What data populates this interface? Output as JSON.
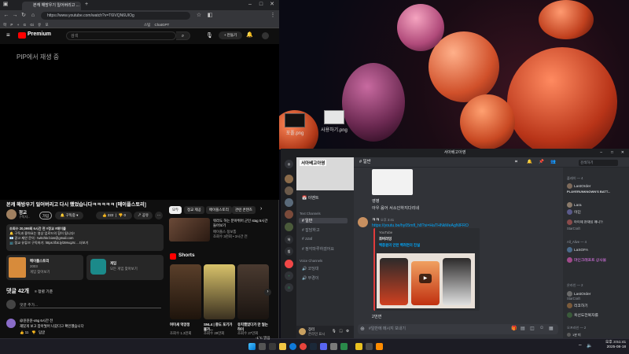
{
  "browser": {
    "tab_title": "본캐 해방우기 일어버리고 ...",
    "new_tab": "+",
    "url": "https://www.youtube.com/watch?v=T6IVQN6UIOg",
    "bookmarks": [
      "학",
      "P",
      "+",
      "G",
      "Gi",
      "유",
      "모",
      "스팀",
      "ChatGPT"
    ]
  },
  "youtube": {
    "logo": "Premium",
    "search_placeholder": "검색",
    "create_label": "+ 만들기",
    "pip_text": "PIP에서 재생 중",
    "video_title": "본캐 해방우기 일어버리고 다시 했었습니다ㅋㅋㅋㅋㅋ [메이플스토리]",
    "channel_name": "정교",
    "channel_subs": "구독자...",
    "join_label": "가입",
    "subscribe_label": "구독중",
    "like_count": "222",
    "dislike_count": "0",
    "share_label": "공유",
    "description": [
      "조회수 20,099회 6시간 전 #정교 #메이플",
      "🔔 구독과 좋아요는 영상 업로드의 힘이 됩니다!",
      "📧 광고 제안 문의 : twitchkr.bios@gmail.com",
      "📺 정교 유튜브 구독하기: https://bit.ly/39rvqJrc    ...더보기"
    ],
    "game_card_title": "메이플스토리",
    "game_card_year": "2003",
    "game_card_link": "게임 찾아보기",
    "game_card2_title": "게임",
    "game_card2_sub": "모든 게임 찾아보기",
    "comments_count": "댓글 42개",
    "sort_label": "정렬 기준",
    "comment_placeholder": "댓글 추가...",
    "comment_author": "@윤윤윤-x5g 6시간 전",
    "comment_text": "재밌게 보고 잡아뒀어 나갔다고 확인했습니다",
    "comment_likes": "11",
    "comment_reply": "답글",
    "chips": [
      "모두",
      "정교 제공",
      "메이플스토리",
      "관련 콘텐츠"
    ],
    "rec_title": "워라도 하는 분야뛰어 군인 stag 5시간 들어보기",
    "rec_channel": "메이플스 정보통",
    "rec_meta": "조회수 3천회 • 3시간 전",
    "shorts_label": "Shorts",
    "shorts": [
      {
        "title": "여미새 억망정",
        "views": "조회수 1.3만회"
      },
      {
        "title": "SNL4 | 중도 포기가 불가...",
        "views": "조회수 29만회"
      },
      {
        "title": "유치했었다가 만 얼는 하이",
        "views": "조회수 27만회"
      }
    ]
  },
  "desktop": {
    "icon1": "포폴.png",
    "icon2": "사용하기.png"
  },
  "discord": {
    "window_title": "서아베고아영",
    "server_name": "서아베고아영",
    "event_label": "이벤트",
    "text_category": "Text Channels",
    "voice_category": "Voice Channels",
    "channels": [
      "일반",
      "잡담하고",
      "zzal",
      "정각마루하겠어요"
    ],
    "voice_channels": [
      "코딩대",
      "부경이"
    ],
    "current_channel": "일반",
    "user_name": "장리",
    "user_status": "온라인 표시",
    "messages": [
      {
        "text": "영병",
        "y": 0
      },
      {
        "text": "아우 음어 서소인하지다리네",
        "y": 1
      }
    ],
    "yt_author": "ㅋㅋ",
    "yt_time": "오후 3:41",
    "yt_link": "https://youtu.be/hy05mfl_h8?si=HaTHNkMeAgNIFRO",
    "embed_source": "YouTube",
    "embed_channel": "쪼버러잉",
    "embed_title": "백종원의 인턴 백려면의 진실",
    "after_msg": "2번면",
    "input_placeholder": "#일반에 메시지 보내기",
    "search_placeholder": "검색하기",
    "member_groups": [
      {
        "label": "플레이 — 4"
      },
      {
        "label": "All_Alive — 4"
      },
      {
        "label": "온라인 — 2"
      },
      {
        "label": "오프라인 — 2"
      }
    ],
    "members": [
      "LastOrder",
      "PLAYERUNKNOWN'S BATT...",
      "Lara",
      "이딘",
      "아이제 현재임 깨니?!",
      "StarCraft",
      "LaSOFA",
      "마인크래프트 상사물",
      "LastOrder",
      "StarCraft",
      "리코하기",
      "흑선도전복자를",
      "1분 미"
    ]
  },
  "taskbar": {
    "weather": "-1°C 맑음",
    "time": "오후 3:51:41",
    "date": "2025-08-18"
  }
}
